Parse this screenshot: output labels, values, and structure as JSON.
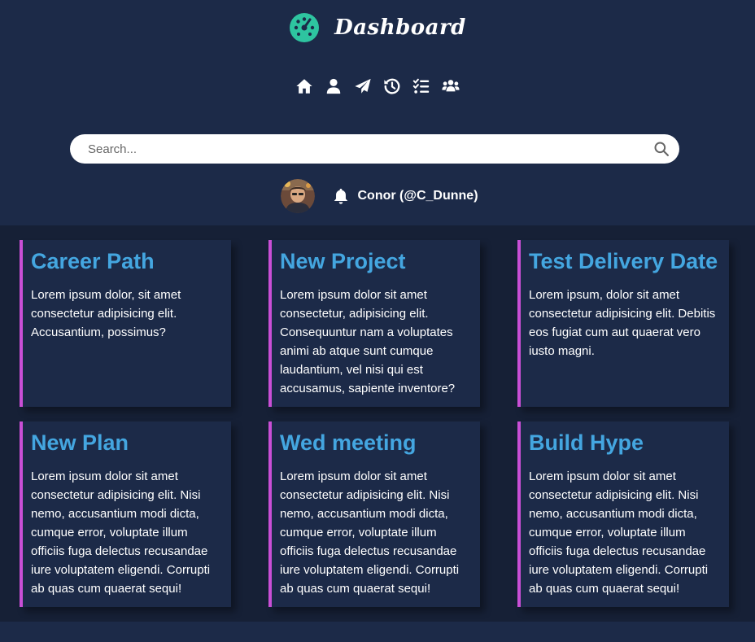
{
  "brand": {
    "title": "Dashboard",
    "logo_icon": "tachometer-icon",
    "accent": "#2ec4a0"
  },
  "nav": {
    "items": [
      {
        "icon": "home-icon"
      },
      {
        "icon": "user-icon"
      },
      {
        "icon": "paper-plane-icon"
      },
      {
        "icon": "history-icon"
      },
      {
        "icon": "tasks-icon"
      },
      {
        "icon": "users-icon"
      }
    ]
  },
  "search": {
    "placeholder": "Search...",
    "value": ""
  },
  "user": {
    "display": "Conor (@C_Dunne)"
  },
  "colors": {
    "header_bg": "#1c2a48",
    "main_bg": "#162036",
    "card_bg": "#1c2a48",
    "card_border": "#c94fd6",
    "card_title": "#44a6e0"
  },
  "cards": [
    {
      "title": "Career Path",
      "body": "Lorem ipsum dolor, sit amet consectetur adipisicing elit. Accusantium, possimus?"
    },
    {
      "title": "New Project",
      "body": "Lorem ipsum dolor sit amet consectetur, adipisicing elit. Consequuntur nam a voluptates animi ab atque sunt cumque laudantium, vel nisi qui est accusamus, sapiente inventore?"
    },
    {
      "title": "Test Delivery Date",
      "body": "Lorem ipsum, dolor sit amet consectetur adipisicing elit. Debitis eos fugiat cum aut quaerat vero iusto magni."
    },
    {
      "title": "New Plan",
      "body": "Lorem ipsum dolor sit amet consectetur adipisicing elit. Nisi nemo, accusantium modi dicta, cumque error, voluptate illum officiis fuga delectus recusandae iure voluptatem eligendi. Corrupti ab quas cum quaerat sequi!"
    },
    {
      "title": "Wed meeting",
      "body": "Lorem ipsum dolor sit amet consectetur adipisicing elit. Nisi nemo, accusantium modi dicta, cumque error, voluptate illum officiis fuga delectus recusandae iure voluptatem eligendi. Corrupti ab quas cum quaerat sequi!"
    },
    {
      "title": "Build Hype",
      "body": "Lorem ipsum dolor sit amet consectetur adipisicing elit. Nisi nemo, accusantium modi dicta, cumque error, voluptate illum officiis fuga delectus recusandae iure voluptatem eligendi. Corrupti ab quas cum quaerat sequi!"
    }
  ]
}
